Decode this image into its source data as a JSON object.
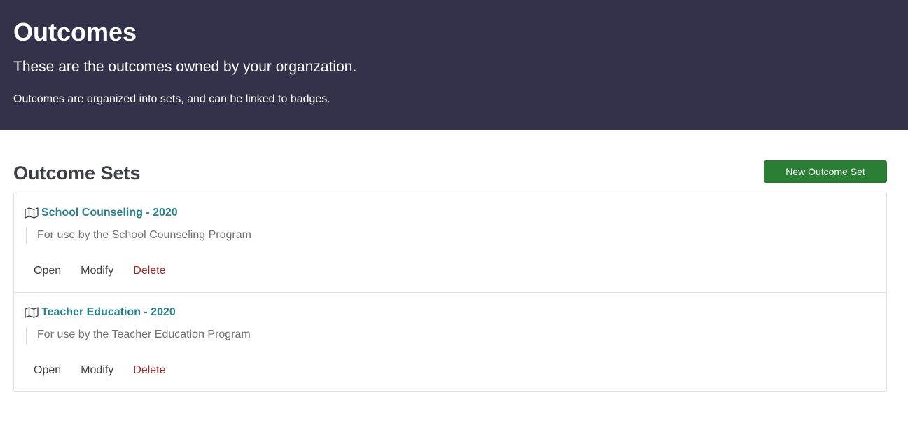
{
  "header": {
    "title": "Outcomes",
    "lead": "These are the outcomes owned by your organzation.",
    "description": "Outcomes are organized into sets, and can be linked to badges."
  },
  "section": {
    "title": "Outcome Sets",
    "new_button_label": "New Outcome Set"
  },
  "outcome_sets": [
    {
      "name": "School Counseling - 2020",
      "description": "For use by the School Counseling Program",
      "icon": "map-icon",
      "actions": {
        "open": "Open",
        "modify": "Modify",
        "delete": "Delete"
      }
    },
    {
      "name": "Teacher Education - 2020",
      "description": "For use by the Teacher Education Program",
      "icon": "map-icon",
      "actions": {
        "open": "Open",
        "modify": "Modify",
        "delete": "Delete"
      }
    }
  ],
  "colors": {
    "header_bg": "#32334b",
    "primary_button": "#2a7f35",
    "link": "#28818c",
    "danger": "#a12c2c"
  }
}
